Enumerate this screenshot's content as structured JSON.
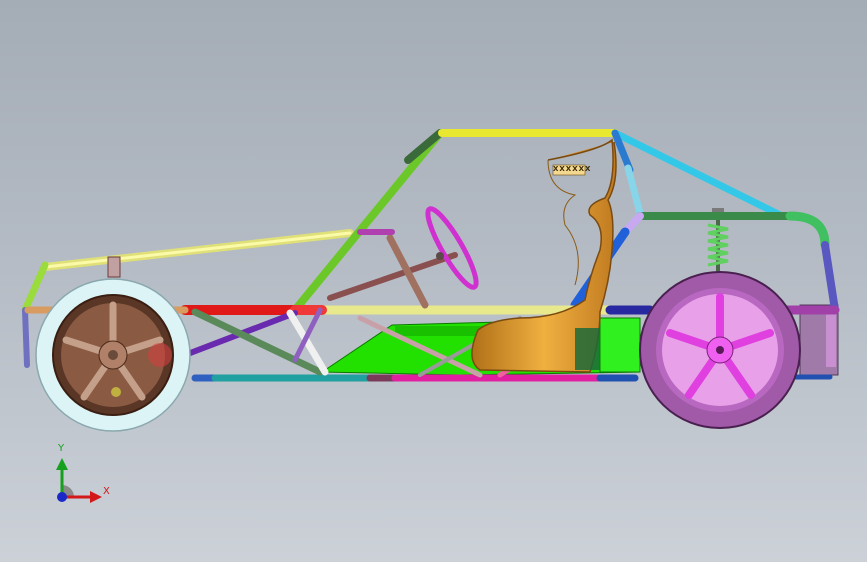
{
  "viewport": {
    "background_top": "#a4acb6",
    "background_bottom": "#ccd1d8"
  },
  "seat": {
    "logo_text": "XXXXXX",
    "color": "#e0a030"
  },
  "triad": {
    "x_label": "X",
    "y_label": "Y",
    "x_color": "#d21818",
    "y_color": "#16a01e",
    "z_color": "#1a28c8"
  },
  "parts": {
    "front_wheel": {
      "tire_color": "#d8f2f4",
      "rim_color": "#7a4a32"
    },
    "rear_wheel": {
      "tire_color": "#b06ac0",
      "rim_color": "#d838d8"
    },
    "steering_wheel_color": "#d030d0",
    "floor_panel_color": "#22e000",
    "rear_spring_color": "#60d060"
  }
}
